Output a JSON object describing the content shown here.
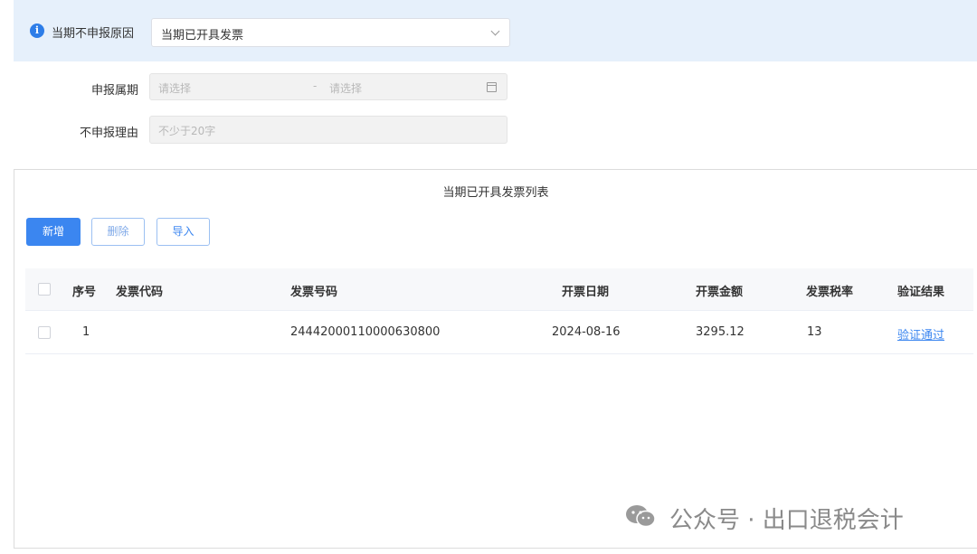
{
  "banner": {
    "label": "当期不申报原因",
    "selected": "当期已开具发票"
  },
  "form": {
    "period_label": "申报属期",
    "period_start_placeholder": "请选择",
    "period_separator": "-",
    "period_end_placeholder": "请选择",
    "reason_label": "不申报理由",
    "reason_placeholder": "不少于20字"
  },
  "panel": {
    "title": "当期已开具发票列表",
    "buttons": {
      "add": "新增",
      "delete": "删除",
      "import": "导入"
    },
    "columns": {
      "index": "序号",
      "invoice_code": "发票代码",
      "invoice_number": "发票号码",
      "issue_date": "开票日期",
      "amount": "开票金额",
      "tax_rate": "发票税率",
      "verify_result": "验证结果"
    },
    "rows": [
      {
        "index": "1",
        "invoice_code": "",
        "invoice_number": "24442000110000630800",
        "issue_date": "2024-08-16",
        "amount": "3295.12",
        "tax_rate": "13",
        "verify_result": "验证通过"
      }
    ]
  },
  "watermark": {
    "text": "公众号 · 出口退税会计",
    "icon": "wechat-icon"
  },
  "colors": {
    "primary": "#3b86f0",
    "banner_bg": "#e6f0fb"
  }
}
